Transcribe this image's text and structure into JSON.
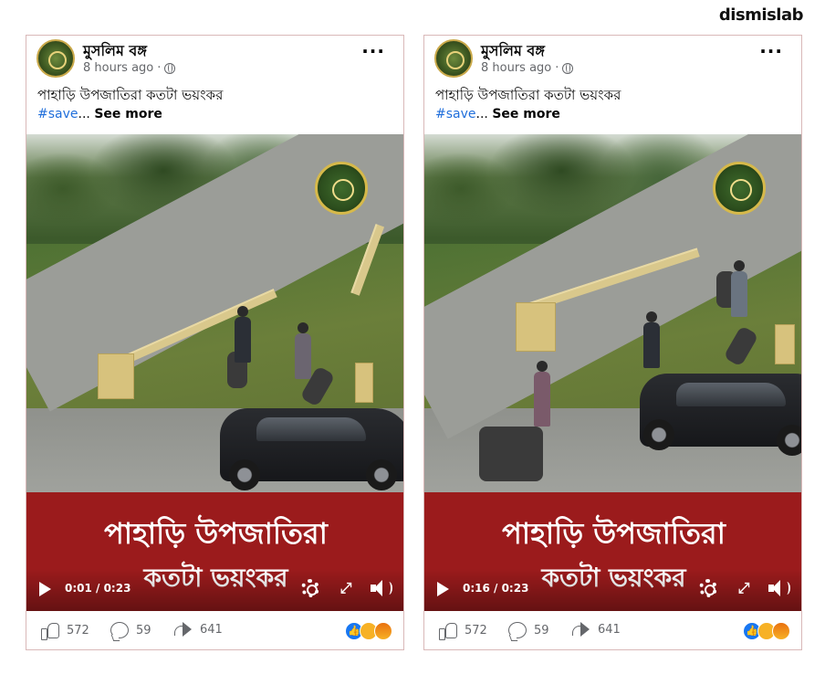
{
  "brand": "dismislab",
  "posts": [
    {
      "page_name": "মুসলিম বঙ্গ",
      "time_ago": "8 hours ago",
      "separator": "·",
      "caption": "পাহাড়ি উপজাতিরা কতটা ভয়ংকর",
      "hashtag": "#save",
      "ellipsis": "...",
      "see_more": "See more",
      "banner_line1": "পাহাড়ি উপজাতিরা",
      "banner_line2": "কতটা ভয়ংকর",
      "video_time": "0:01 / 0:23",
      "likes": "572",
      "comments": "59",
      "shares": "641"
    },
    {
      "page_name": "মুসলিম বঙ্গ",
      "time_ago": "8 hours ago",
      "separator": "·",
      "caption": "পাহাড়ি উপজাতিরা কতটা ভয়ংকর",
      "hashtag": "#save",
      "ellipsis": "...",
      "see_more": "See more",
      "banner_line1": "পাহাড়ি উপজাতিরা",
      "banner_line2": "কতটা ভয়ংকর",
      "video_time": "0:16 / 0:23",
      "likes": "572",
      "comments": "59",
      "shares": "641"
    }
  ],
  "colors": {
    "banner": "#9b1b1c",
    "link": "#216fdb",
    "muted": "#65676b",
    "like_reaction": "#1877f2"
  },
  "icons": [
    "globe-icon",
    "more-icon",
    "play-icon",
    "gear-icon",
    "fullscreen-icon",
    "volume-icon",
    "like-icon",
    "comment-icon",
    "share-icon"
  ]
}
